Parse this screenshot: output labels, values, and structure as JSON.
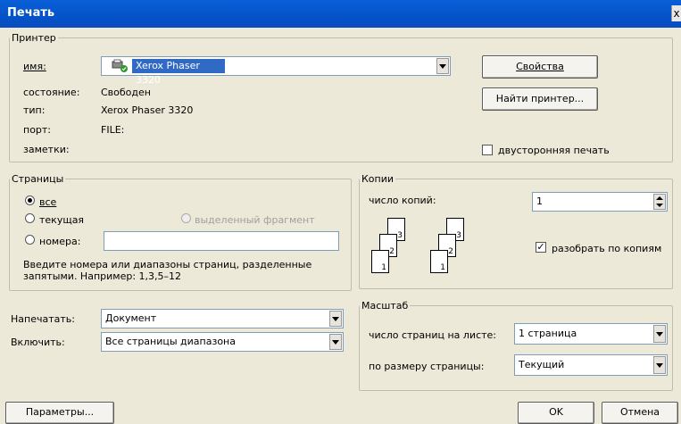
{
  "window": {
    "title": "Печать",
    "close": "x"
  },
  "printer": {
    "group_label": "Принтер",
    "name_label": "имя:",
    "name_value": "Xerox Phaser 3320",
    "status_label": "состояние:",
    "status_value": "Свободен",
    "type_label": "тип:",
    "type_value": "Xerox Phaser 3320",
    "port_label": "порт:",
    "port_value": "FILE:",
    "notes_label": "заметки:",
    "properties_button": "Свойства",
    "find_button": "Найти принтер...",
    "duplex_label": "двусторонняя печать"
  },
  "pages": {
    "group_label": "Страницы",
    "all_label": "все",
    "current_label": "текущая",
    "selection_label": "выделенный фрагмент",
    "numbers_label": "номера:",
    "numbers_value": "",
    "hint": "Введите номера или диапазоны страниц, разделенные запятыми. Например: 1,3,5–12"
  },
  "copies": {
    "group_label": "Копии",
    "count_label": "число копий:",
    "count_value": "1",
    "collate_label": "разобрать по копиям",
    "page_numbers": [
      "1",
      "2",
      "3"
    ]
  },
  "print_what": {
    "label": "Напечатать:",
    "value": "Документ"
  },
  "include": {
    "label": "Включить:",
    "value": "Все страницы диапазона"
  },
  "zoom": {
    "group_label": "Масштаб",
    "pages_per_sheet_label": "число страниц на листе:",
    "pages_per_sheet_value": "1 страница",
    "scale_label": "по размеру страницы:",
    "scale_value": "Текущий"
  },
  "buttons": {
    "options": "Параметры...",
    "ok": "OK",
    "cancel": "Отмена"
  }
}
